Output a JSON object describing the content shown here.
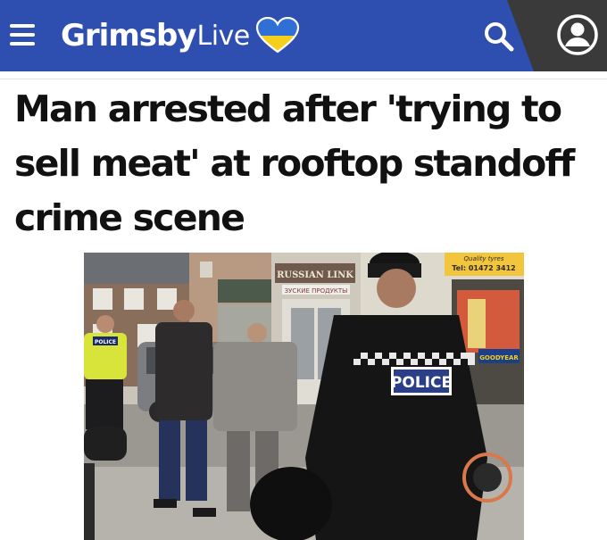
{
  "header": {
    "brand_bold": "Grimsby",
    "brand_light": "Live",
    "brand_colors": {
      "bar": "#2f4fb0",
      "account_panel": "#3a3a3a",
      "heart_top": "#2f6fd6",
      "heart_bottom": "#f4cf1c"
    },
    "icons": [
      "menu-icon",
      "heart-logo-icon",
      "search-icon",
      "account-icon"
    ]
  },
  "article": {
    "headline": "Man arrested after 'trying to sell meat' at rooftop standoff crime scene"
  },
  "photo": {
    "signs": {
      "shop_sign": "RUSSIAN LINK",
      "shop_subsign": "ЗУСКИЕ ПРОДУКТЫ",
      "quality_sign": "Quality tyres",
      "tel": "Tel: 01472 3412",
      "tyre_brand": "GOODYEAR"
    },
    "vest_label": "POLICE",
    "jacket_label": "POLICE"
  }
}
